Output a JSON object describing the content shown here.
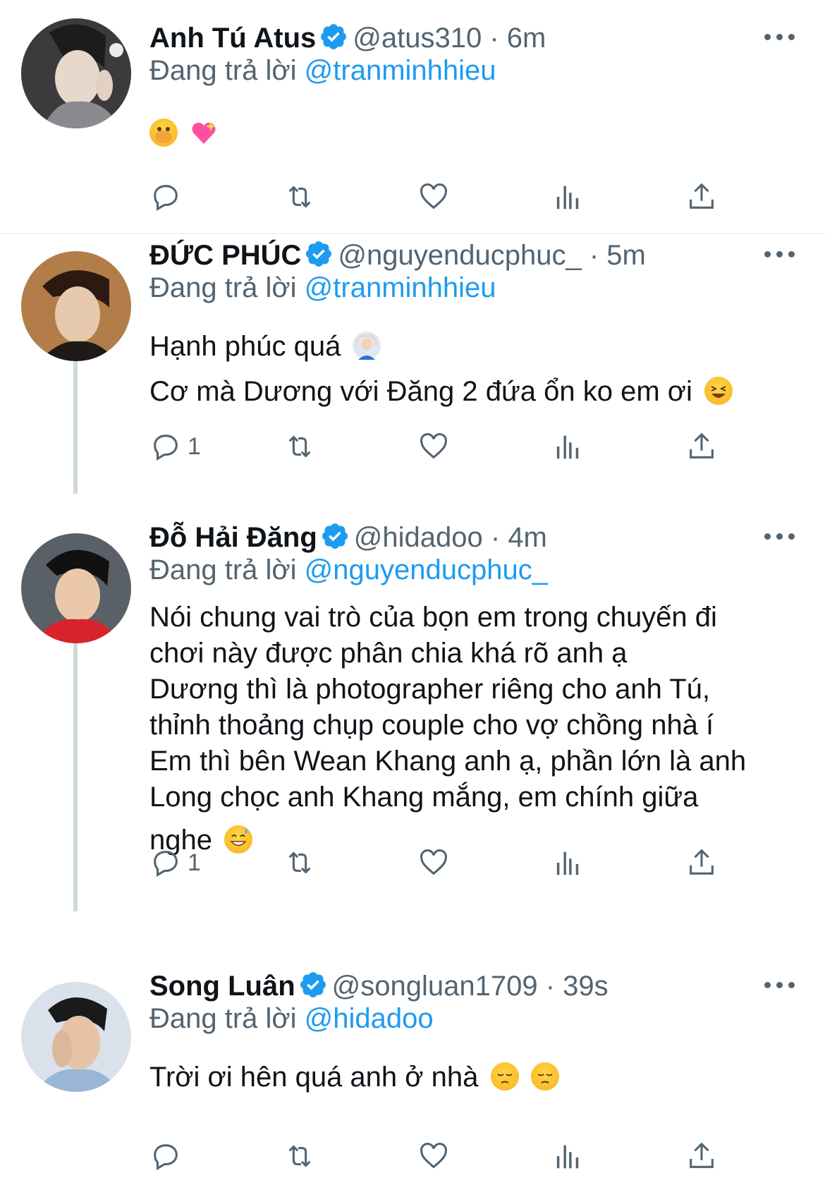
{
  "tweets": [
    {
      "name": "Anh Tú Atus",
      "handle": "@atus310",
      "time": "6m",
      "replying_label": "Đang trả lời",
      "replying_to": "@tranminhhieu",
      "lines": [],
      "emoji_line": [
        "face-with-open-eyes-and-hand-over-mouth-emoji",
        "sparkling-heart-emoji"
      ],
      "reply_count": ""
    },
    {
      "name": "ĐỨC PHÚC",
      "handle": "@nguyenducphuc_",
      "time": "5m",
      "replying_label": "Đang trả lời",
      "replying_to": "@tranminhhieu",
      "lines": [
        "Hạnh phúc quá",
        "Cơ mà Dương với Đăng 2 đứa ổn ko em ơi"
      ],
      "line_emojis": [
        "person-gesturing-ok-emoji",
        "grinning-squinting-face-emoji"
      ],
      "reply_count": "1"
    },
    {
      "name": "Đỗ Hải Đăng",
      "handle": "@hidadoo",
      "time": "4m",
      "replying_label": "Đang trả lời",
      "replying_to": "@nguyenducphuc_",
      "lines": [
        "Nói chung vai trò của bọn em trong chuyến đi",
        "chơi này được phân chia khá rõ anh ạ",
        "Dương thì là photographer riêng cho anh Tú,",
        "thỉnh thoảng chụp couple cho vợ chồng nhà í",
        "Em thì bên Wean Khang anh ạ, phần lớn là anh",
        "Long chọc anh Khang mắng, em chính giữa",
        "nghe"
      ],
      "last_line_emoji": "grinning-face-with-sweat-emoji",
      "reply_count": "1"
    },
    {
      "name": "Song Luân",
      "handle": "@songluan1709",
      "time": "39s",
      "replying_label": "Đang trả lời",
      "replying_to": "@hidadoo",
      "lines": [
        "Trời ơi hên quá anh ở nhà"
      ],
      "line_emojis": [
        "pensive-face-emoji",
        "pensive-face-emoji"
      ],
      "reply_count": ""
    }
  ],
  "colors": {
    "text": "#0f1419",
    "secondary": "#536471",
    "link": "#1d9bf0",
    "verified": "#1d9bf0",
    "thread_line": "#cfd9de"
  }
}
